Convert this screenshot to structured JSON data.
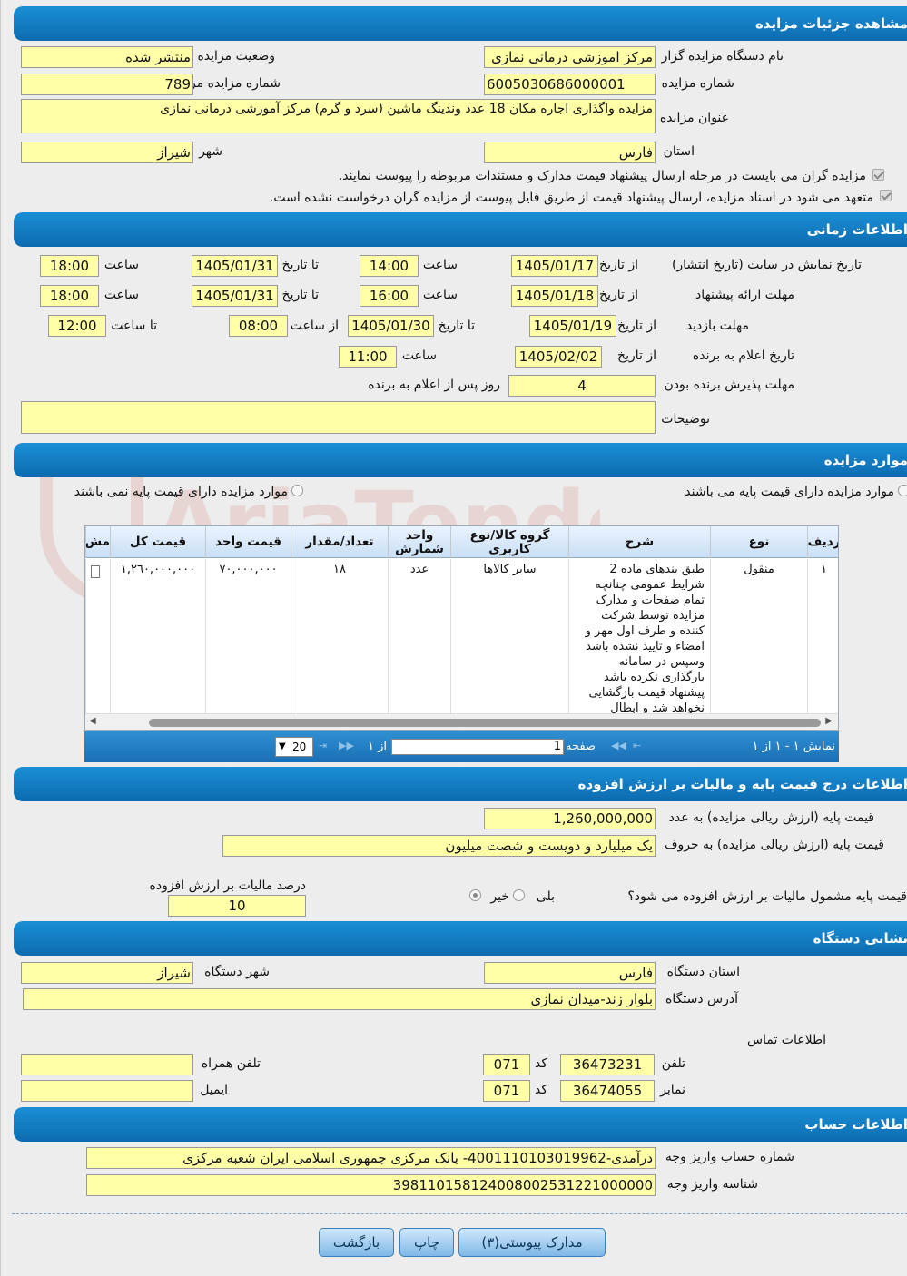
{
  "sections": {
    "details": "مشاهده جزئیات مزایده",
    "timing": "اطلاعات زمانی",
    "items": "موارد مزایده",
    "price": "اطلاعات درج قیمت پایه و مالیات بر ارزش افزوده",
    "address": "نشانی دستگاه",
    "account": "اطلاعات حساب"
  },
  "details": {
    "org_label": "نام دستگاه مزایده گزار",
    "org_value": "مرکز اموزشی درمانی نمازی",
    "status_label": "وضعیت مزایده",
    "status_value": "منتشر شده",
    "number_label": "شماره مزایده",
    "number_value": "6005030686000001",
    "ref_label": "شماره مزایده مرجع",
    "ref_value": "789",
    "title_label": "عنوان مزایده",
    "title_value": "مزایده واگذاری اجاره مکان 18 عدد وندینگ ماشین (سرد و گرم) مرکز آموزشی درمانی نمازی",
    "province_label": "استان",
    "province_value": "فارس",
    "city_label": "شهر",
    "city_value": "شیراز",
    "check1": "مزایده گران می بایست در مرحله ارسال پیشنهاد قیمت مدارک و مستندات مربوطه را پیوست نمایند.",
    "check2": "متعهد می شود در اسناد مزایده، ارسال پیشنهاد قیمت از طریق فایل پیوست از مزایده گران درخواست نشده است."
  },
  "timing": {
    "display_label": "تاریخ نمایش در سایت (تاریخ انتشار)",
    "from_date_label": "از تاریخ",
    "to_date_label": "تا تاریخ",
    "hour_label": "ساعت",
    "display_from_date": "1405/01/17",
    "display_from_time": "14:00",
    "display_to_date": "1405/01/31",
    "display_to_time": "18:00",
    "offer_label": "مهلت ارائه پیشنهاد",
    "offer_from_date": "1405/01/18",
    "offer_from_time": "16:00",
    "offer_to_date": "1405/01/31",
    "offer_to_time": "18:00",
    "visit_label": "مهلت بازدید",
    "from_hour_label": "از ساعت",
    "to_hour_label": "تا ساعت",
    "visit_from_date": "1405/01/19",
    "visit_to_date": "1405/01/30",
    "visit_from_time": "08:00",
    "visit_to_time": "12:00",
    "winner_label": "تاریخ اعلام به برنده",
    "winner_date": "1405/02/02",
    "winner_time": "11:00",
    "accept_label": "مهلت پذیرش برنده بودن",
    "accept_value": "4",
    "accept_suffix": "روز پس از اعلام به برنده",
    "notes_label": "توضیحات",
    "notes_value": ""
  },
  "items": {
    "radio_with": "موارد مزایده دارای قیمت پایه می باشند",
    "radio_without": "موارد مزایده دارای قیمت پایه نمی باشند",
    "headers": {
      "row": "ردیف",
      "type": "نوع",
      "desc": "شرح",
      "group": "گروه کالا/نوع کاربری",
      "unit": "واحد شمارش",
      "qty": "تعداد/مقدار",
      "unit_price": "قیمت واحد",
      "total": "قیمت کل",
      "more": "مش"
    },
    "rows": [
      {
        "row": "١",
        "type": "منقول",
        "desc": "طبق بندهای ماده 2 شرایط عمومی چنانچه تمام صفحات و مدارک مزایده توسط شرکت کننده و طرف اول مهر و امضاء و تایید نشده باشد وسپس در سامانه بارگذاری نکرده باشد پیشنهاد قیمت بازگشایی نخواهد شد و ابطال میگردد",
        "group": "سایر کالاها",
        "unit": "عدد",
        "qty": "١٨",
        "unit_price": "٧٠,٠٠٠,٠٠٠",
        "total": "١,٢٦٠,٠٠٠,٠٠٠"
      }
    ],
    "pager": {
      "showing": "نمایش ١ - ١ از ١",
      "page_label": "صفحه",
      "page_value": "1",
      "of_label": "از ١",
      "page_size": "20"
    }
  },
  "price": {
    "base_num_label": "قیمت پایه (ارزش ریالی مزایده) به عدد",
    "base_num_value": "1,260,000,000",
    "base_text_label": "قیمت پایه (ارزش ریالی مزایده) به حروف",
    "base_text_value": "یک میلیارد و دویست و شصت میلیون",
    "vat_question": "قیمت پایه مشمول مالیات بر ارزش افزوده می شود؟",
    "yes": "بلی",
    "no": "خیر",
    "vat_percent_label": "درصد مالیات بر ارزش افزوده",
    "vat_percent_value": "10"
  },
  "address": {
    "province_label": "استان دستگاه",
    "province_value": "فارس",
    "city_label": "شهر دستگاه",
    "city_value": "شیراز",
    "address_label": "آدرس دستگاه",
    "address_value": "بلوار زند-میدان نمازی",
    "contact_label": "اطلاعات تماس",
    "phone_label": "تلفن",
    "phone_value": "36473231",
    "code_label": "کد",
    "phone_code": "071",
    "mobile_label": "تلفن همراه",
    "mobile_value": "",
    "fax_label": "نمابر",
    "fax_value": "36474055",
    "fax_code": "071",
    "email_label": "ایمیل",
    "email_value": ""
  },
  "account": {
    "acc_label": "شماره حساب واریز وجه",
    "acc_value": "درآمدی-4001110103019962- بانک مرکزی جمهوری اسلامی ایران شعبه مرکزی",
    "id_label": "شناسه واریز وجه",
    "id_value": "398110158124008002531221000000"
  },
  "buttons": {
    "attachments": "مدارک پیوستی(٣)",
    "print": "چاپ",
    "back": "بازگشت"
  },
  "watermark": "AriaTender.neT"
}
